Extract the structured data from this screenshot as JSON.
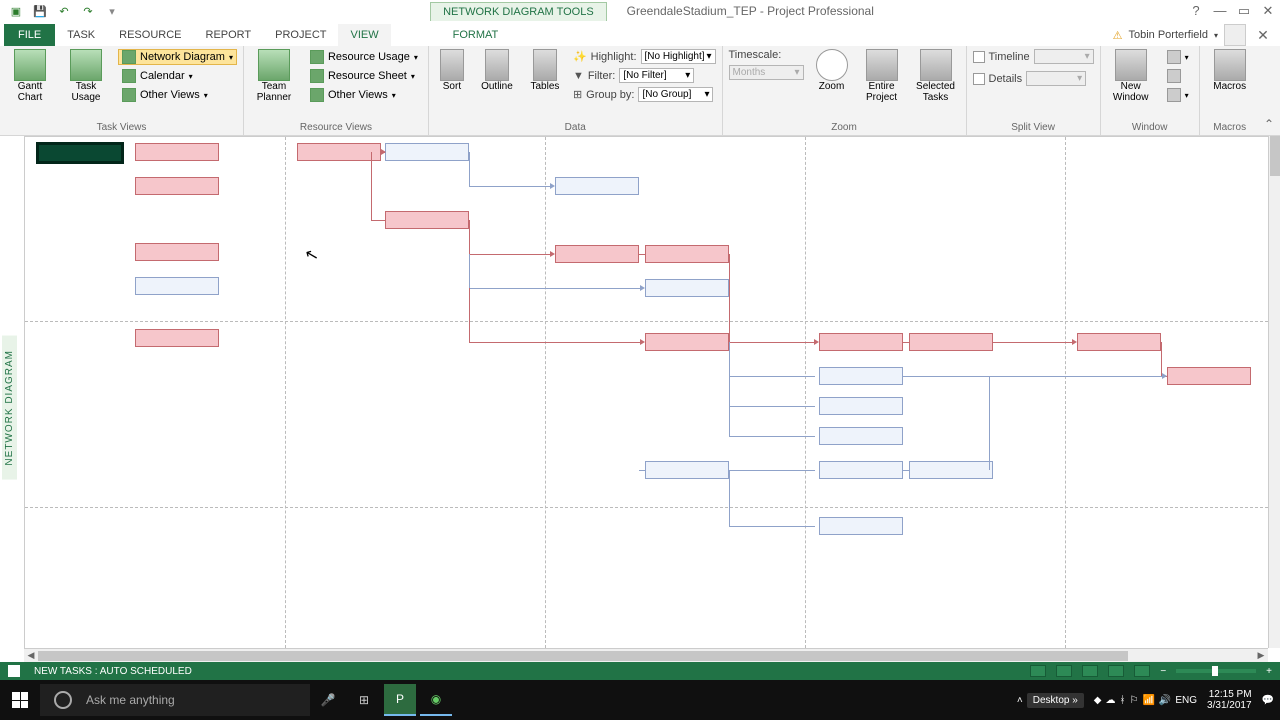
{
  "app": {
    "tool_context": "NETWORK DIAGRAM TOOLS",
    "doc_title": "GreendaleStadium_TEP - Project Professional"
  },
  "tabs": {
    "file": "FILE",
    "list": [
      "TASK",
      "RESOURCE",
      "REPORT",
      "PROJECT",
      "VIEW"
    ],
    "context": "FORMAT",
    "active": "VIEW"
  },
  "user": {
    "name": "Tobin Porterfield"
  },
  "ribbon": {
    "task_views": {
      "gantt": "Gantt Chart",
      "task_usage": "Task Usage",
      "network_diagram": "Network Diagram",
      "calendar": "Calendar",
      "other": "Other Views",
      "label": "Task Views"
    },
    "resource_views": {
      "team_planner": "Team Planner",
      "resource_usage": "Resource Usage",
      "resource_sheet": "Resource Sheet",
      "other": "Other Views",
      "label": "Resource Views"
    },
    "data": {
      "sort": "Sort",
      "outline": "Outline",
      "tables": "Tables",
      "highlight_label": "Highlight:",
      "highlight_value": "[No Highlight]",
      "filter_label": "Filter:",
      "filter_value": "[No Filter]",
      "group_label": "Group by:",
      "group_value": "[No Group]",
      "label": "Data"
    },
    "zoom": {
      "timescale_label": "Timescale:",
      "timescale_value": "Months",
      "zoom": "Zoom",
      "entire": "Entire Project",
      "selected": "Selected Tasks",
      "label": "Zoom"
    },
    "split_view": {
      "timeline": "Timeline",
      "details": "Details",
      "label": "Split View"
    },
    "window": {
      "new_window": "New Window",
      "label": "Window"
    },
    "macros": {
      "macros": "Macros",
      "label": "Macros"
    }
  },
  "diagram": {
    "sidebar_label": "NETWORK DIAGRAM"
  },
  "status": {
    "new_tasks": "NEW TASKS : AUTO SCHEDULED"
  },
  "taskbar": {
    "search_placeholder": "Ask me anything",
    "desktop_label": "Desktop",
    "lang": "ENG",
    "time": "12:15 PM",
    "date": "3/31/2017"
  }
}
